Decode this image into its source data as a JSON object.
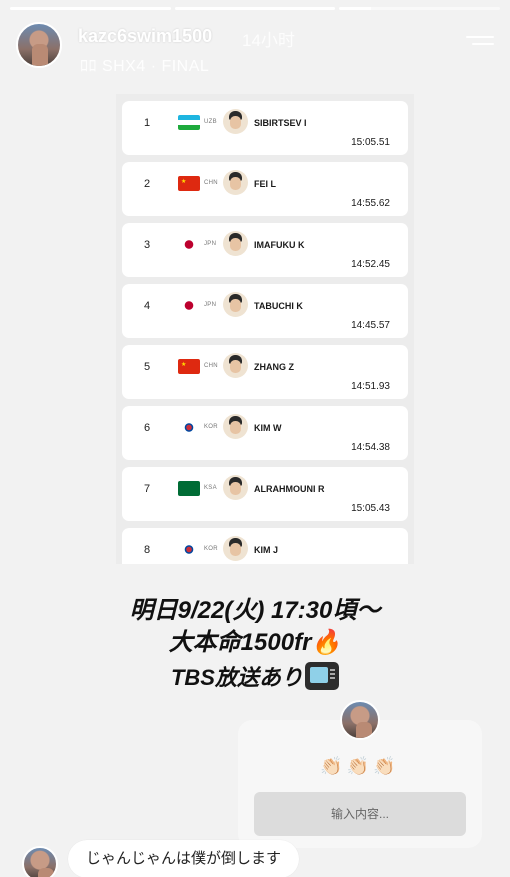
{
  "story": {
    "progress": [
      1,
      1,
      0.2
    ],
    "username": "kazc6swim1500",
    "time": "14小时",
    "subline": "ﾛﾛ SHX4 · FINAL"
  },
  "results": [
    {
      "rank": "1",
      "flag": "uzb",
      "code": "UZB",
      "name": "SIBIRTSEV I",
      "time": "15:05.51"
    },
    {
      "rank": "2",
      "flag": "chn",
      "code": "CHN",
      "name": "FEI L",
      "time": "14:55.62"
    },
    {
      "rank": "3",
      "flag": "jpn",
      "code": "JPN",
      "name": "IMAFUKU K",
      "time": "14:52.45"
    },
    {
      "rank": "4",
      "flag": "jpn",
      "code": "JPN",
      "name": "TABUCHI K",
      "time": "14:45.57"
    },
    {
      "rank": "5",
      "flag": "chn",
      "code": "CHN",
      "name": "ZHANG Z",
      "time": "14:51.93"
    },
    {
      "rank": "6",
      "flag": "kor",
      "code": "KOR",
      "name": "KIM W",
      "time": "14:54.38"
    },
    {
      "rank": "7",
      "flag": "ksa",
      "code": "KSA",
      "name": "ALRAHMOUNI R",
      "time": "15:05.43"
    },
    {
      "rank": "8",
      "flag": "kor",
      "code": "KOR",
      "name": "KIM J",
      "time": ""
    }
  ],
  "overlay": {
    "line1": "明日9/22(火) 17:30頃〜",
    "line2": "大本命1500fr🔥",
    "line3": "TBS放送あり"
  },
  "question": {
    "claps": "👏🏻👏🏻👏🏻",
    "placeholder": "输入内容..."
  },
  "reply": {
    "text": "じゃんじゃんは僕が倒します"
  }
}
